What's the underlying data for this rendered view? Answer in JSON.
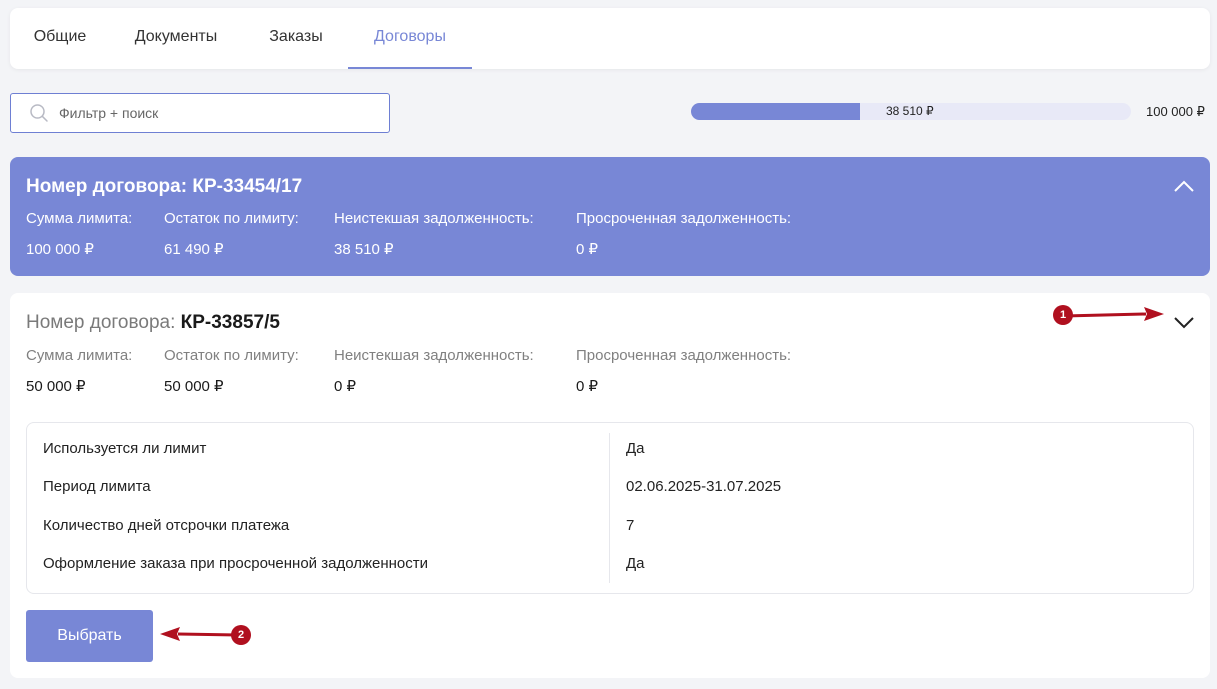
{
  "tabs": [
    {
      "label": "Общие"
    },
    {
      "label": "Документы"
    },
    {
      "label": "Заказы"
    },
    {
      "label": "Договоры",
      "active": true
    }
  ],
  "search": {
    "placeholder": "Фильтр + поиск"
  },
  "limit_bar": {
    "used_label": "38 510 ₽",
    "total_label": "100 000 ₽",
    "fraction": 0.3851
  },
  "contracts": [
    {
      "title_prefix": "Номер договора:",
      "number": "КР-33454/17",
      "expanded": false,
      "labels": [
        "Сумма лимита:",
        "Остаток по лимиту:",
        "Неистекшая задолженность:",
        "Просроченная задолженность:"
      ],
      "values": [
        "100 000 ₽",
        "61 490 ₽",
        "38 510 ₽",
        "0 ₽"
      ],
      "toggle_icon": "chevron-up-icon"
    },
    {
      "title_prefix": "Номер договора:",
      "number": "КР-33857/5",
      "expanded": true,
      "labels": [
        "Сумма лимита:",
        "Остаток по лимиту:",
        "Неистекшая задолженность:",
        "Просроченная задолженность:"
      ],
      "values": [
        "50 000 ₽",
        "50 000 ₽",
        "0 ₽",
        "0 ₽"
      ],
      "toggle_icon": "chevron-down-icon",
      "details": [
        {
          "key": "Используется ли лимит",
          "value": "Да"
        },
        {
          "key": "Период лимита",
          "value": "02.06.2025-31.07.2025"
        },
        {
          "key": "Количество дней отсрочки платежа",
          "value": "7"
        },
        {
          "key": "Оформление заказа при просроченной задолженности",
          "value": "Да"
        }
      ],
      "select_button": "Выбрать"
    }
  ],
  "annotations": [
    {
      "number": "1"
    },
    {
      "number": "2"
    }
  ],
  "colors": {
    "accent": "#7887d6",
    "annotation": "#b0101f",
    "background": "#f3f4f7"
  }
}
